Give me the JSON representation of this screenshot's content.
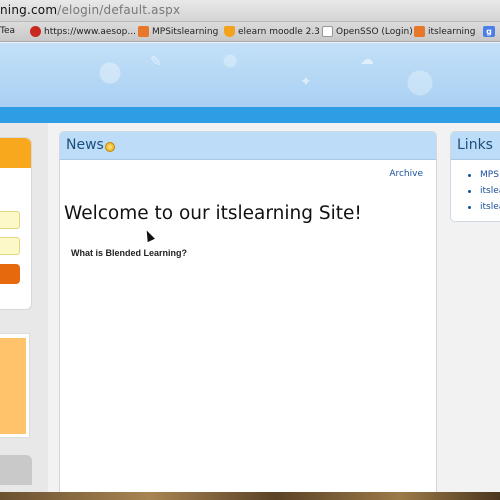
{
  "browser": {
    "url_host": "ning.com",
    "url_path": "/elogin/default.aspx",
    "bookmarks": [
      {
        "label": "Tea",
        "icon": "page-icon"
      },
      {
        "label": "https://www.aesop...",
        "icon": "aesop-icon"
      },
      {
        "label": "MPSitslearning",
        "icon": "mps-icon"
      },
      {
        "label": "elearn moodle 2.3",
        "icon": "moodle-icon"
      },
      {
        "label": "OpenSSO (Login)",
        "icon": "page-icon"
      },
      {
        "label": "itslearning",
        "icon": "mps-icon"
      },
      {
        "label": "g",
        "icon": "google-icon"
      }
    ]
  },
  "news": {
    "title": "News",
    "archive_link": "Archive",
    "welcome": "Welcome to our itslearning Site!",
    "subheading": "What is Blended Learning?"
  },
  "links": {
    "title": "Links",
    "items": [
      "MPS",
      "itslea",
      "itslea"
    ]
  },
  "colors": {
    "banner": "#b9daf6",
    "nav_strip": "#2f9de3",
    "login_header": "#f7a81d",
    "login_button": "#e66a0c",
    "panel_header": "#bcdcf7"
  }
}
